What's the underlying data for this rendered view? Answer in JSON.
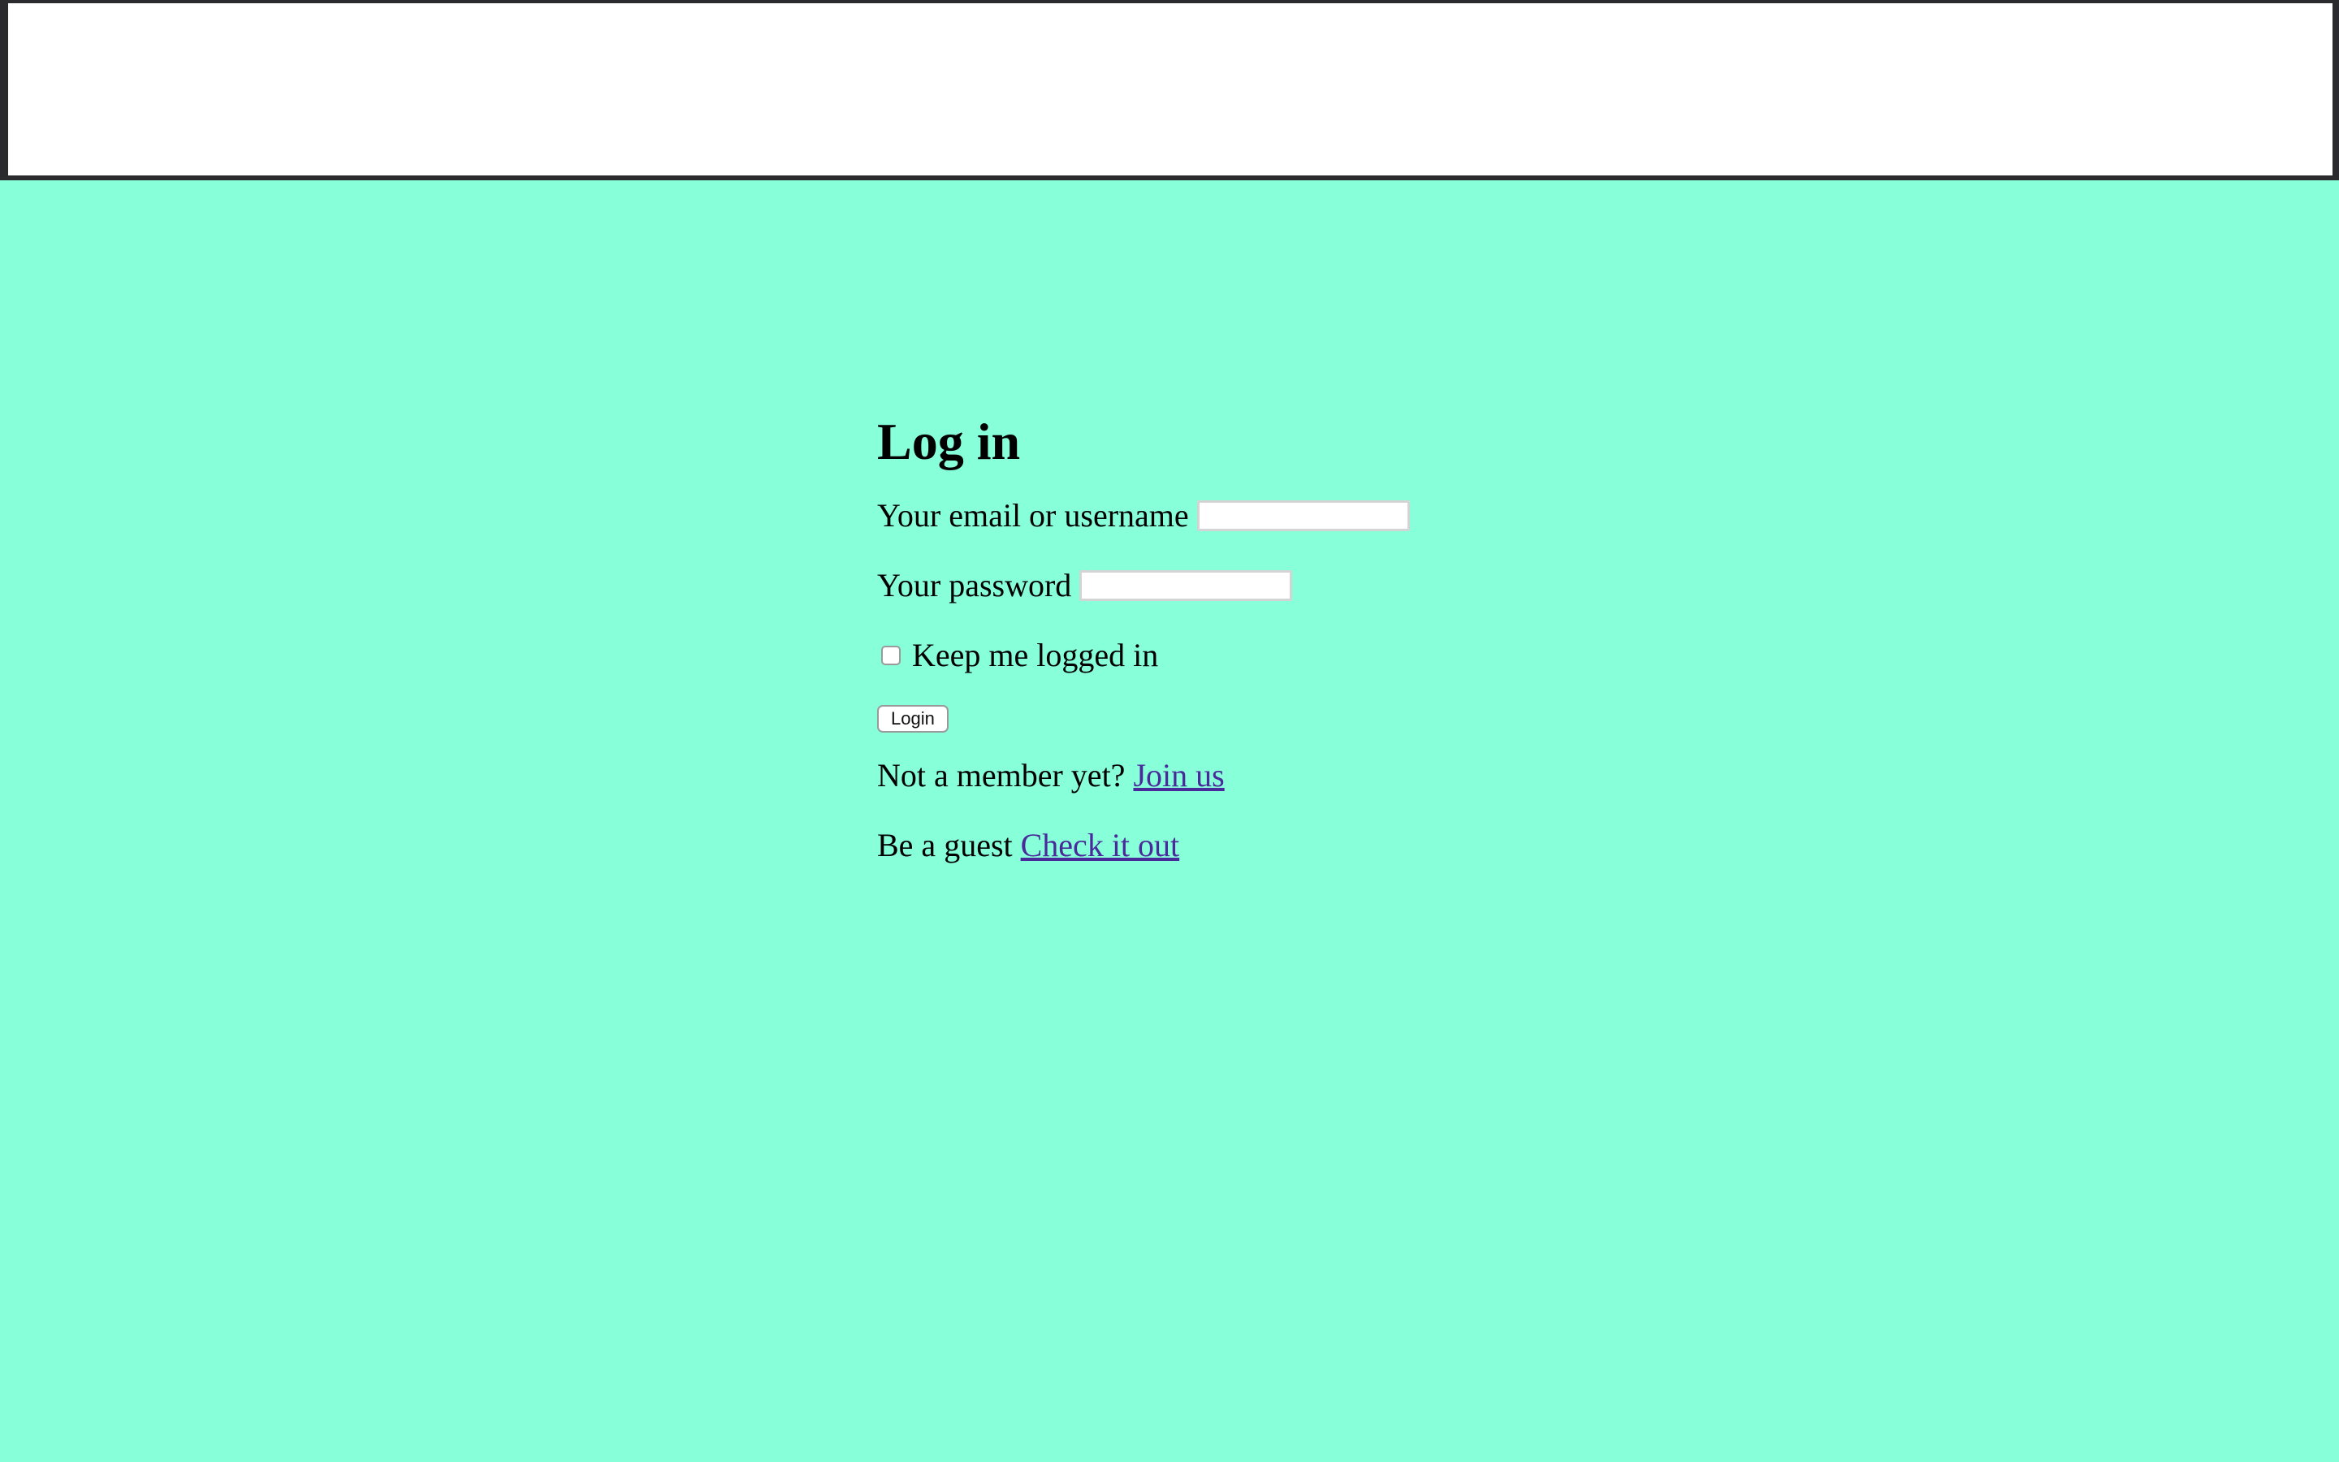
{
  "colors": {
    "page_background": "#87ffd8",
    "top_frame": "#2b2b2e",
    "link": "#4a2a9a"
  },
  "login_form": {
    "title": "Log in",
    "email_label": "Your email or username",
    "email_value": "",
    "password_label": "Your password",
    "password_value": "",
    "keep_logged_in_label": "Keep me logged in",
    "keep_logged_in_checked": false,
    "login_button_label": "Login"
  },
  "signup": {
    "prompt": "Not a member yet?",
    "link_text": "Join us"
  },
  "guest": {
    "prompt": "Be a guest",
    "link_text": "Check it out"
  }
}
